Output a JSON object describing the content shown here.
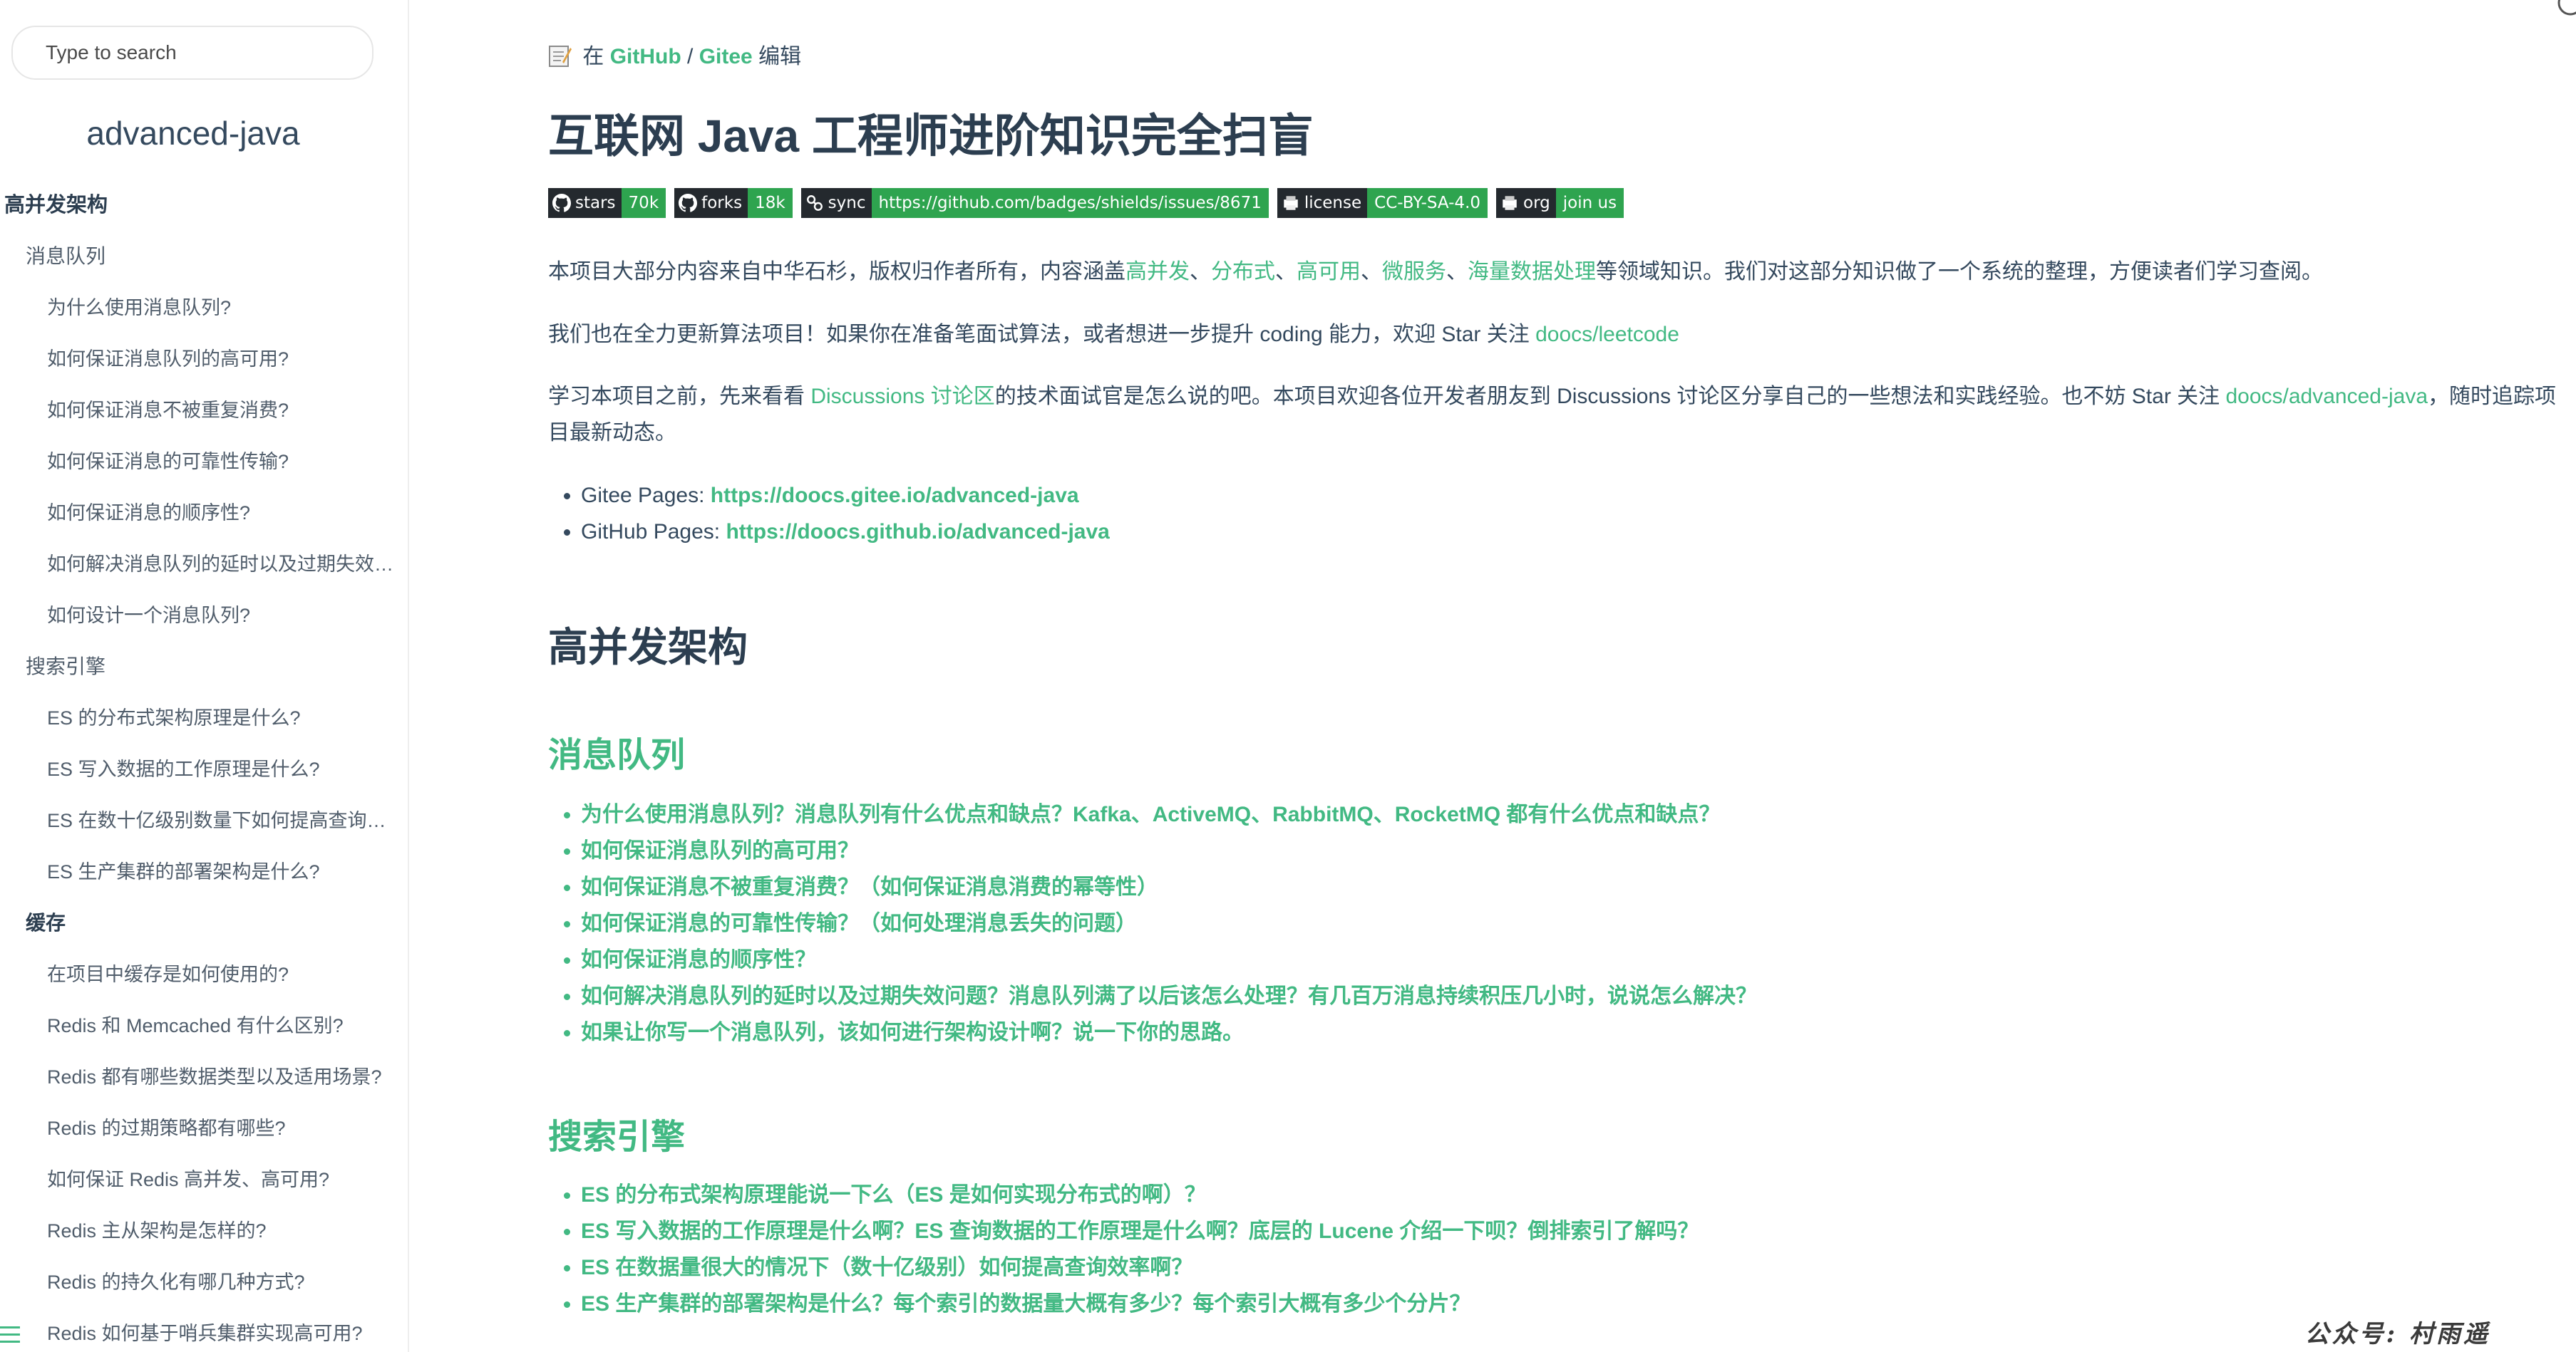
{
  "search": {
    "placeholder": "Type to search"
  },
  "app_name": "advanced-java",
  "sidebar": {
    "items": [
      {
        "level": 0,
        "label": "高并发架构"
      },
      {
        "level": 1,
        "label": "消息队列"
      },
      {
        "level": 2,
        "label": "为什么使用消息队列?"
      },
      {
        "level": 2,
        "label": "如何保证消息队列的高可用?"
      },
      {
        "level": 2,
        "label": "如何保证消息不被重复消费?"
      },
      {
        "level": 2,
        "label": "如何保证消息的可靠性传输?"
      },
      {
        "level": 2,
        "label": "如何保证消息的顺序性?"
      },
      {
        "level": 2,
        "label": "如何解决消息队列的延时以及过期失效问题?"
      },
      {
        "level": 2,
        "label": "如何设计一个消息队列?"
      },
      {
        "level": 1,
        "label": "搜索引擎"
      },
      {
        "level": 2,
        "label": "ES 的分布式架构原理是什么?"
      },
      {
        "level": 2,
        "label": "ES 写入数据的工作原理是什么?"
      },
      {
        "level": 2,
        "label": "ES 在数十亿级别数量下如何提高查询效率?"
      },
      {
        "level": 2,
        "label": "ES 生产集群的部署架构是什么?"
      },
      {
        "level": 1,
        "label": "缓存",
        "bold": true
      },
      {
        "level": 2,
        "label": "在项目中缓存是如何使用的?"
      },
      {
        "level": 2,
        "label": "Redis 和 Memcached 有什么区别?"
      },
      {
        "level": 2,
        "label": "Redis 都有哪些数据类型以及适用场景?"
      },
      {
        "level": 2,
        "label": "Redis 的过期策略都有哪些?"
      },
      {
        "level": 2,
        "label": "如何保证 Redis 高并发、高可用?"
      },
      {
        "level": 2,
        "label": "Redis 主从架构是怎样的?"
      },
      {
        "level": 2,
        "label": "Redis 的持久化有哪几种方式?"
      },
      {
        "level": 2,
        "label": "Redis 如何基于哨兵集群实现高可用?"
      }
    ]
  },
  "edit": {
    "prefix": "在",
    "github": "GitHub",
    "sep": "/",
    "gitee": "Gitee",
    "suffix": "编辑"
  },
  "title": "互联网 Java 工程师进阶知识完全扫盲",
  "badges": [
    {
      "label": "stars",
      "value": "70k",
      "icon": "github-icon"
    },
    {
      "label": "forks",
      "value": "18k",
      "icon": "github-icon"
    },
    {
      "label": "sync",
      "value": "https://github.com/badges/shields/issues/8671",
      "icon": "sync-icon"
    },
    {
      "label": "license",
      "value": "CC-BY-SA-4.0",
      "icon": "printer-icon"
    },
    {
      "label": "org",
      "value": "join us",
      "icon": "printer-icon"
    }
  ],
  "intro": {
    "p1_a": "本项目大部分内容来自中华石杉，版权归作者所有，内容涵盖",
    "p1_l1": "高并发",
    "p1_s1": "、",
    "p1_l2": "分布式",
    "p1_s2": "、",
    "p1_l3": "高可用",
    "p1_s3": "、",
    "p1_l4": "微服务",
    "p1_s4": "、",
    "p1_l5": "海量数据处理",
    "p1_b": "等领域知识。我们对这部分知识做了一个系统的整理，方便读者们学习查阅。",
    "p2_a": "我们也在全力更新算法项目！如果你在准备笔面试算法，或者想进一步提升 coding 能力，欢迎 Star 关注 ",
    "p2_link": "doocs/leetcode",
    "p3_a": "学习本项目之前，先来看看 ",
    "p3_link1": "Discussions 讨论区",
    "p3_b": "的技术面试官是怎么说的吧。本项目欢迎各位开发者朋友到 Discussions 讨论区分享自己的一些想法和实践经验。也不妨 Star 关注 ",
    "p3_link2": "doocs/advanced-java",
    "p3_c": "，随时追踪项目最新动态。"
  },
  "pages": [
    {
      "label": "Gitee Pages: ",
      "url": "https://doocs.gitee.io/advanced-java"
    },
    {
      "label": "GitHub Pages: ",
      "url": "https://doocs.github.io/advanced-java"
    }
  ],
  "section_title": "高并发架构",
  "mq": {
    "title": "消息队列",
    "items": [
      "为什么使用消息队列？消息队列有什么优点和缺点？Kafka、ActiveMQ、RabbitMQ、RocketMQ 都有什么优点和缺点？",
      "如何保证消息队列的高可用？",
      "如何保证消息不被重复消费？（如何保证消息消费的幂等性）",
      "如何保证消息的可靠性传输？（如何处理消息丢失的问题）",
      "如何保证消息的顺序性？",
      "如何解决消息队列的延时以及过期失效问题？消息队列满了以后该怎么处理？有几百万消息持续积压几小时，说说怎么解决？",
      "如果让你写一个消息队列，该如何进行架构设计啊？说一下你的思路。"
    ]
  },
  "search_engine": {
    "title": "搜索引擎",
    "items": [
      "ES 的分布式架构原理能说一下么（ES 是如何实现分布式的啊）？",
      "ES 写入数据的工作原理是什么啊？ES 查询数据的工作原理是什么啊？底层的 Lucene 介绍一下呗？倒排索引了解吗？",
      "ES 在数据量很大的情况下（数十亿级别）如何提高查询效率啊？",
      "ES 生产集群的部署架构是什么？每个索引的数据量大概有多少？每个索引大概有多少个分片？"
    ]
  },
  "watermark": "公众号: 村雨遥",
  "colors": {
    "accent": "#42b983",
    "text": "#34495e",
    "heading": "#2c3e50",
    "badge_dark": "#24292e",
    "badge_green": "#2ea44f"
  }
}
